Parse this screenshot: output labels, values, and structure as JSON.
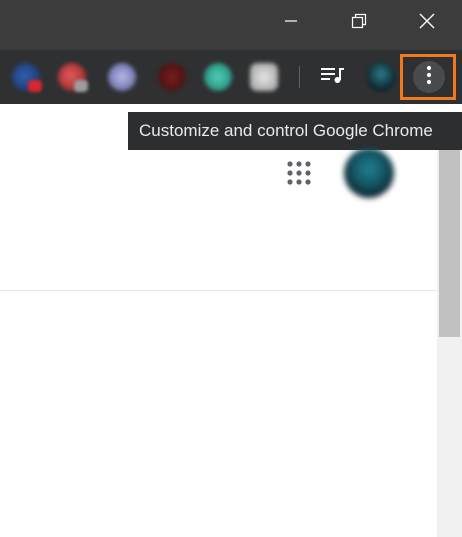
{
  "window": {
    "controls": [
      {
        "name": "minimize",
        "icon": "minimize-icon"
      },
      {
        "name": "restore",
        "icon": "restore-icon"
      },
      {
        "name": "close",
        "icon": "close-icon"
      }
    ]
  },
  "toolbar": {
    "extensions": [
      "extension-icon",
      "extension-icon",
      "extension-icon",
      "extension-icon",
      "extension-icon",
      "extension-icon"
    ],
    "media_icon": "media-control-icon",
    "profile_icon": "profile-avatar",
    "menu_icon": "more-vert-icon"
  },
  "tooltip": {
    "text": "Customize and control Google Chrome"
  },
  "page": {
    "apps_icon": "apps-grid-icon",
    "account_avatar": "account-avatar"
  },
  "colors": {
    "titlebar": "#3c3c3c",
    "toolbar": "#2f3031",
    "highlight": "#f07a1d",
    "tooltip_bg": "#2d2e30"
  }
}
